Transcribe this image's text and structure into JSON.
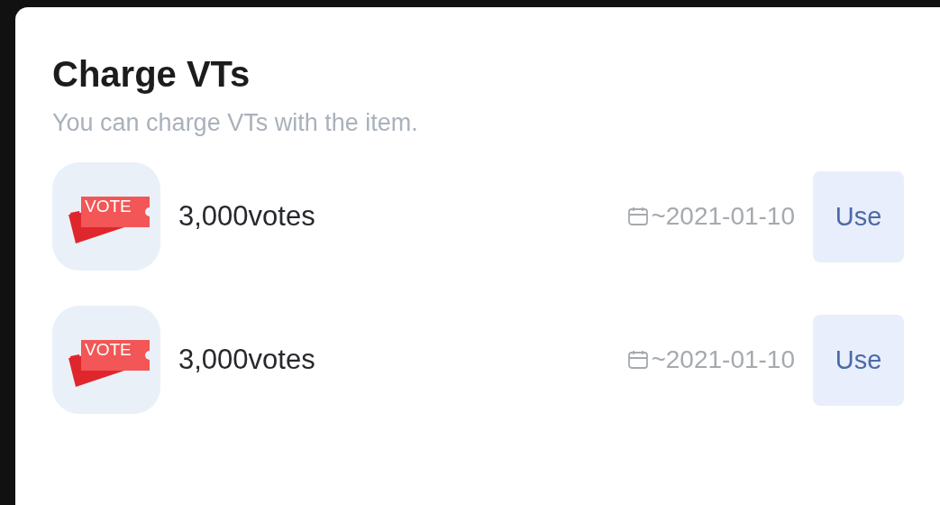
{
  "title": "Charge VTs",
  "subtitle": "You can charge VTs with the item.",
  "items": [
    {
      "ticket_label": "VOTE",
      "amount": "3,000votes",
      "expiry": "~2021-01-10",
      "button": "Use"
    },
    {
      "ticket_label": "VOTE",
      "amount": "3,000votes",
      "expiry": "~2021-01-10",
      "button": "Use"
    }
  ]
}
